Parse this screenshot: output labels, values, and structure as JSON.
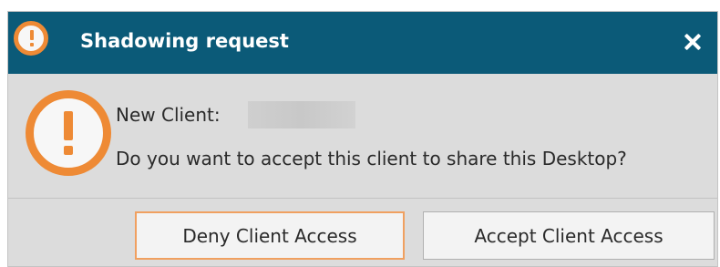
{
  "dialog": {
    "title": "Shadowing request",
    "title_icon": "warning-exclamation-icon",
    "close_icon": "close-icon",
    "message_icon": "warning-exclamation-icon",
    "new_client_label": "New Client:",
    "question": "Do you want to accept this client to share this Desktop?",
    "deny_label": "Deny Client Access",
    "accept_label": "Accept Client Access"
  },
  "colors": {
    "titlebar": "#0b5a78",
    "warning_accent": "#ee8a35",
    "body_background": "#dcdcdc"
  }
}
